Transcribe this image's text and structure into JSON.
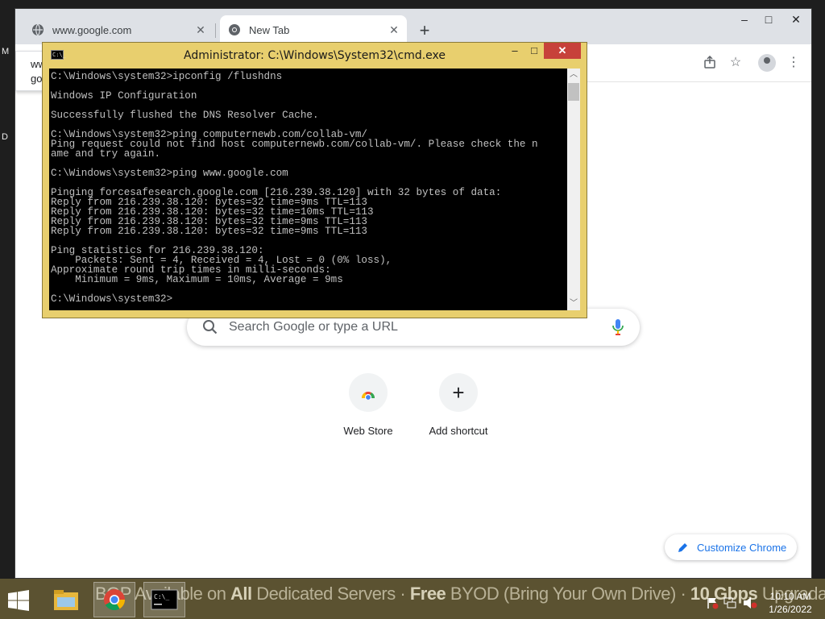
{
  "browser": {
    "tabs": [
      {
        "title": "www.google.com",
        "active": false
      },
      {
        "title": "New Tab",
        "active": true
      }
    ],
    "new_tab_label": "+",
    "window_controls": {
      "minimize": "–",
      "maximize": "□",
      "close": "✕"
    },
    "suggestion": {
      "line1": "ww",
      "line2": "go"
    },
    "ntp": {
      "search_placeholder": "Search Google or type a URL",
      "shortcuts": [
        {
          "label": "Web Store",
          "icon": "webstore-icon"
        },
        {
          "label": "Add shortcut",
          "icon": "plus-icon",
          "glyph": "+"
        }
      ],
      "customize_label": "Customize Chrome"
    },
    "colors": {
      "accent": "#1a73e8",
      "tabstrip": "#dee1e6"
    }
  },
  "desktop": {
    "edge_text_1": "M",
    "edge_text_2": "D"
  },
  "cmd": {
    "title": "Administrator: C:\\Windows\\System32\\cmd.exe",
    "icon_text": "C:\\_",
    "lines": [
      "C:\\Windows\\system32>ipconfig /flushdns",
      "",
      "Windows IP Configuration",
      "",
      "Successfully flushed the DNS Resolver Cache.",
      "",
      "C:\\Windows\\system32>ping computernewb.com/collab-vm/",
      "Ping request could not find host computernewb.com/collab-vm/. Please check the n",
      "ame and try again.",
      "",
      "C:\\Windows\\system32>ping www.google.com",
      "",
      "Pinging forcesafesearch.google.com [216.239.38.120] with 32 bytes of data:",
      "Reply from 216.239.38.120: bytes=32 time=9ms TTL=113",
      "Reply from 216.239.38.120: bytes=32 time=10ms TTL=113",
      "Reply from 216.239.38.120: bytes=32 time=9ms TTL=113",
      "Reply from 216.239.38.120: bytes=32 time=9ms TTL=113",
      "",
      "Ping statistics for 216.239.38.120:",
      "    Packets: Sent = 4, Received = 4, Lost = 0 (0% loss),",
      "Approximate round trip times in milli-seconds:",
      "    Minimum = 9ms, Maximum = 10ms, Average = 9ms",
      "",
      "C:\\Windows\\system32>"
    ],
    "colors": {
      "frame": "#e8cf6e",
      "close": "#c7413a",
      "console_bg": "#000000",
      "console_fg": "#c0c0c0"
    }
  },
  "taskbar": {
    "banner": {
      "p1": "BGP Available on ",
      "b1": "All",
      "p2": " Dedicated Servers · ",
      "b2": "Free",
      "p3": " BYOD (Bring Your Own Drive) · ",
      "b3": "10 Gbps",
      "p4": " Upgradable"
    },
    "apps": [
      "file-explorer-icon",
      "chrome-icon",
      "cmd-icon"
    ],
    "clock": {
      "time": "10:10 AM",
      "date": "1/26/2022"
    },
    "colors": {
      "background": "#5b5231"
    }
  }
}
